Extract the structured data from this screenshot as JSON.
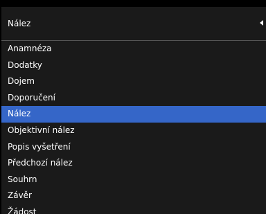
{
  "dropdown": {
    "selected_value": "Nález",
    "options": [
      {
        "label": "Anamnéza",
        "selected": false
      },
      {
        "label": "Dodatky",
        "selected": false
      },
      {
        "label": "Dojem",
        "selected": false
      },
      {
        "label": "Doporučení",
        "selected": false
      },
      {
        "label": "Nález",
        "selected": true
      },
      {
        "label": "Objektivní nález",
        "selected": false
      },
      {
        "label": "Popis vyšetření",
        "selected": false
      },
      {
        "label": "Předchozí nález",
        "selected": false
      },
      {
        "label": "Souhrn",
        "selected": false
      },
      {
        "label": "Závěr",
        "selected": false
      },
      {
        "label": "Žádost",
        "selected": false
      }
    ]
  },
  "colors": {
    "background": "#1a1a1a",
    "highlight": "#3566c8",
    "text": "#ffffff",
    "divider": "#555555"
  },
  "icons": {
    "dropdown_arrow": "triangle-left-icon"
  }
}
